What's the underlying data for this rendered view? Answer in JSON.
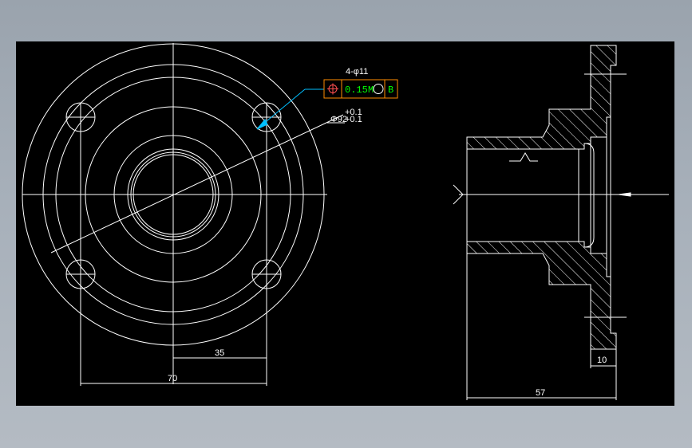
{
  "colors": {
    "background_outer": "#a7b0ba",
    "canvas": "#000000",
    "line": "#ffffff",
    "leader": "#00bfff",
    "tol_frame": "#ff8c00",
    "tol_text": "#00ff00",
    "tol_symbol": "#ff5050"
  },
  "front_view": {
    "hole_callout": "4-φ11",
    "bore_dim": "Φ92",
    "bore_tol_upper": "+0.1",
    "bore_tol_lower": "+0.1",
    "dim_half_pitch": "35",
    "dim_pitch": "70"
  },
  "tolerance_frame": {
    "symbol": "position-icon",
    "value": "0.15",
    "modifier": "M",
    "datum": "B"
  },
  "section_view": {
    "dim_flange_thickness": "10",
    "dim_length": "57"
  }
}
